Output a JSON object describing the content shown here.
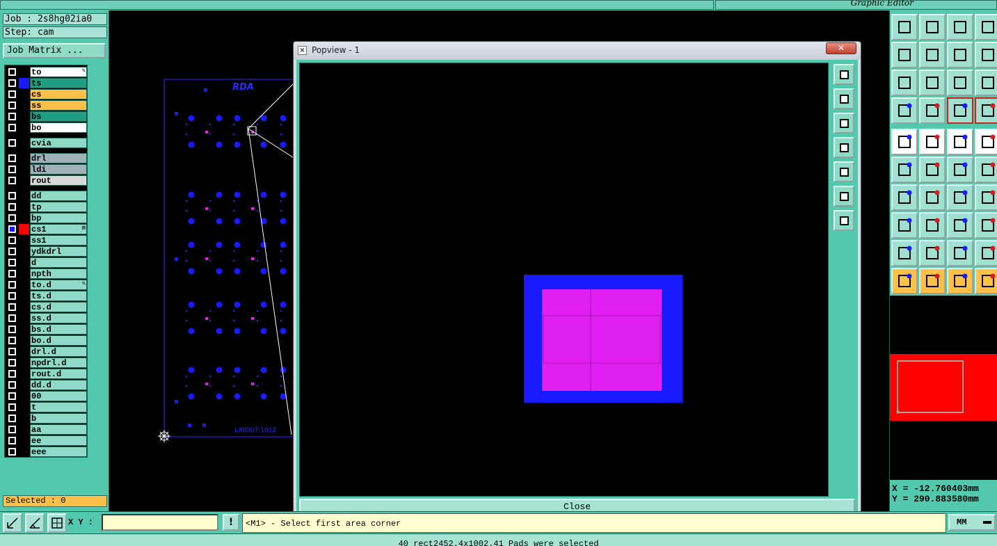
{
  "window": {
    "title": "Graphic Editor"
  },
  "job": {
    "job_line": "Job : 2s8hg02ia0",
    "step_line": "Step: cam",
    "matrix_button": "Job Matrix ..."
  },
  "colors": {
    "panel": "#52c9ad",
    "accent_red": "#ff0000",
    "pad_blue": "#1a1aff",
    "pad_magenta": "#e020f0",
    "selected_orange": "#ffc04a"
  },
  "layers": [
    {
      "name": "to",
      "bg": "#ffffff",
      "swatch": "#000000",
      "mark": "✎"
    },
    {
      "name": "ts",
      "bg": "#1f9e84",
      "swatch": "#1a1aff",
      "mark": ""
    },
    {
      "name": "cs",
      "bg": "#ffc04a",
      "swatch": "#000000",
      "mark": ""
    },
    {
      "name": "ss",
      "bg": "#ffc04a",
      "swatch": "#000000",
      "mark": ""
    },
    {
      "name": "bs",
      "bg": "#1f9e84",
      "swatch": "#000000",
      "mark": ""
    },
    {
      "name": "bo",
      "bg": "#ffffff",
      "swatch": "#000000",
      "mark": ""
    },
    {
      "name": "cvia",
      "bg": "#8fd9c7",
      "swatch": "#000000",
      "mark": ""
    },
    {
      "name": "drl",
      "bg": "#a0b0b8",
      "swatch": "#000000",
      "mark": ""
    },
    {
      "name": "ldi",
      "bg": "#a0b0b8",
      "swatch": "#000000",
      "mark": ""
    },
    {
      "name": "rout",
      "bg": "#d8d8d8",
      "swatch": "#000000",
      "mark": ""
    },
    {
      "name": "dd",
      "bg": "#8fd9c7",
      "swatch": "#000000",
      "mark": ""
    },
    {
      "name": "tp",
      "bg": "#8fd9c7",
      "swatch": "#000000",
      "mark": ""
    },
    {
      "name": "bp",
      "bg": "#8fd9c7",
      "swatch": "#000000",
      "mark": ""
    },
    {
      "name": "cs1",
      "bg": "#8fd9c7",
      "swatch": "#ff0000",
      "mark": "⊞",
      "active": true
    },
    {
      "name": "ss1",
      "bg": "#8fd9c7",
      "swatch": "#000000",
      "mark": ""
    },
    {
      "name": "ydkdrl",
      "bg": "#8fd9c7",
      "swatch": "#000000",
      "mark": ""
    },
    {
      "name": "d",
      "bg": "#8fd9c7",
      "swatch": "#000000",
      "mark": ""
    },
    {
      "name": "npth",
      "bg": "#8fd9c7",
      "swatch": "#000000",
      "mark": ""
    },
    {
      "name": "to.d",
      "bg": "#8fd9c7",
      "swatch": "#000000",
      "mark": "✎"
    },
    {
      "name": "ts.d",
      "bg": "#8fd9c7",
      "swatch": "#000000",
      "mark": ""
    },
    {
      "name": "cs.d",
      "bg": "#8fd9c7",
      "swatch": "#000000",
      "mark": ""
    },
    {
      "name": "ss.d",
      "bg": "#8fd9c7",
      "swatch": "#000000",
      "mark": ""
    },
    {
      "name": "bs.d",
      "bg": "#8fd9c7",
      "swatch": "#000000",
      "mark": ""
    },
    {
      "name": "bo.d",
      "bg": "#8fd9c7",
      "swatch": "#000000",
      "mark": ""
    },
    {
      "name": "drl.d",
      "bg": "#8fd9c7",
      "swatch": "#000000",
      "mark": ""
    },
    {
      "name": "npdrl.d",
      "bg": "#8fd9c7",
      "swatch": "#000000",
      "mark": ""
    },
    {
      "name": "rout.d",
      "bg": "#8fd9c7",
      "swatch": "#000000",
      "mark": ""
    },
    {
      "name": "dd.d",
      "bg": "#8fd9c7",
      "swatch": "#000000",
      "mark": ""
    },
    {
      "name": "00",
      "bg": "#8fd9c7",
      "swatch": "#000000",
      "mark": ""
    },
    {
      "name": "t",
      "bg": "#8fd9c7",
      "swatch": "#000000",
      "mark": ""
    },
    {
      "name": "b",
      "bg": "#8fd9c7",
      "swatch": "#000000",
      "mark": ""
    },
    {
      "name": "aa",
      "bg": "#8fd9c7",
      "swatch": "#000000",
      "mark": ""
    },
    {
      "name": "ee",
      "bg": "#8fd9c7",
      "swatch": "#000000",
      "mark": ""
    },
    {
      "name": "eee",
      "bg": "#8fd9c7",
      "swatch": "#000000",
      "mark": ""
    }
  ],
  "selected": "Selected : 0",
  "board": {
    "logo_text": "RDA",
    "footer_text": "LAYOUT-1012"
  },
  "popview": {
    "title": "Popview - 1",
    "close_x": "✕",
    "close_button": "Close"
  },
  "coords": {
    "x": "X = -12.760403mm",
    "y": "Y = 290.883580mm"
  },
  "bottom": {
    "xy_label": "X Y :",
    "xy_value": "",
    "warn": "!",
    "prompt": "<M1> - Select first area corner",
    "units": "MM"
  },
  "status": "40 rect2452.4x1002.41 Pads were selected"
}
